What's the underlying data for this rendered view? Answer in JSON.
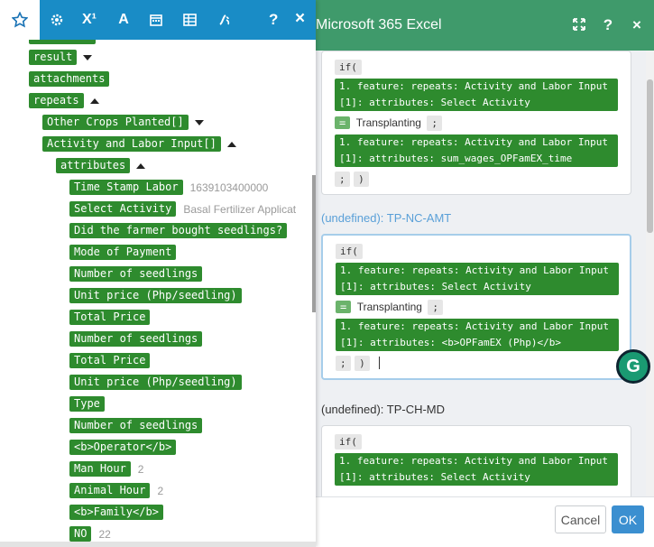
{
  "dialog": {
    "title": "Microsoft 365 Excel",
    "cancel_label": "Cancel",
    "ok_label": "OK",
    "header_icons": [
      "expand-icon",
      "help-icon",
      "close-icon"
    ],
    "fields": [
      {
        "label": "",
        "if_label": "if(",
        "cond_pill": "1. feature: repeats: Activity and Labor Input[1]: attributes: Select Activity",
        "eq_label": "=",
        "eq_text": "Transplanting",
        "sep": ";",
        "value_pill": "1. feature: repeats: Activity and Labor Input[1]: attributes: sum_wages_OPFamEX_time",
        "end_sep": ";",
        "end_paren": ")"
      },
      {
        "label": "(undefined): TP-NC-AMT",
        "if_label": "if(",
        "cond_pill": "1. feature: repeats: Activity and Labor Input[1]: attributes: Select Activity",
        "eq_label": "=",
        "eq_text": "Transplanting",
        "sep": ";",
        "value_pill": "1. feature: repeats: Activity and Labor Input[1]: attributes: <b>OPFamEX (Php)</b>",
        "end_sep": ";",
        "end_paren": ")"
      },
      {
        "label": "(undefined): TP-CH-MD",
        "if_label": "if(",
        "cond_pill": "1. feature: repeats: Activity and Labor Input[1]: attributes: Select Activity"
      }
    ]
  },
  "panel": {
    "tabs": [
      "star-icon",
      "gear-icon",
      "superscript-icon",
      "text-icon",
      "calendar-icon",
      "table-icon",
      "function-icon"
    ],
    "tab_labels": {
      "superscript": "X¹",
      "text": "A"
    },
    "help_label": "?",
    "close_label": "×",
    "tree": [
      {
        "label": "result",
        "caret": "down"
      },
      {
        "label": "attachments"
      },
      {
        "label": "repeats",
        "caret": "up"
      },
      {
        "label": "Other Crops Planted[]",
        "caret": "down"
      },
      {
        "label": "Activity and Labor Input[]",
        "caret": "up"
      },
      {
        "label": "attributes",
        "caret": "up"
      },
      {
        "label": "Time Stamp Labor",
        "value": "1639103400000"
      },
      {
        "label": "Select Activity",
        "value": "Basal Fertilizer Applicat"
      },
      {
        "label": "Did the farmer bought seedlings?"
      },
      {
        "label": "Mode of Payment"
      },
      {
        "label": "Number of seedlings"
      },
      {
        "label": "Unit price (Php/seedling)"
      },
      {
        "label": "Total Price"
      },
      {
        "label": "Number of seedlings"
      },
      {
        "label": "Total Price"
      },
      {
        "label": "Unit price (Php/seedling)"
      },
      {
        "label": "Type"
      },
      {
        "label": "Number of seedlings"
      },
      {
        "label": "<b>Operator</b>"
      },
      {
        "label": "Man Hour",
        "value": "2"
      },
      {
        "label": "Animal Hour",
        "value": "2"
      },
      {
        "label": "<b>Family</b>"
      },
      {
        "label": "NO",
        "value": "22"
      }
    ]
  }
}
